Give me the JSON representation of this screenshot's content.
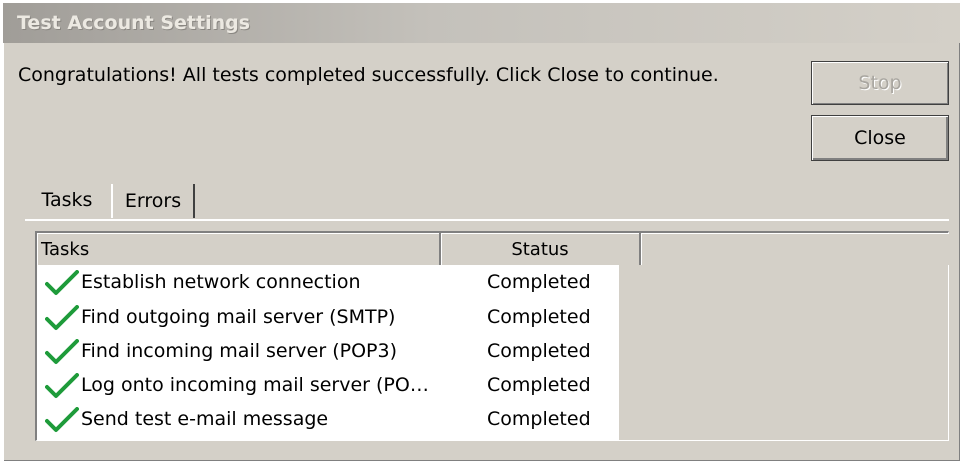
{
  "window": {
    "title": "Test Account Settings"
  },
  "message": "Congratulations! All tests completed successfully. Click Close to continue.",
  "buttons": {
    "stop": "Stop",
    "close": "Close"
  },
  "tabs": [
    {
      "label": "Tasks",
      "selected": true
    },
    {
      "label": "Errors",
      "selected": false
    }
  ],
  "table": {
    "columns": [
      "Tasks",
      "Status"
    ],
    "rows": [
      {
        "task": "Establish network connection",
        "status": "Completed",
        "icon": "check-icon"
      },
      {
        "task": "Find outgoing mail server (SMTP)",
        "status": "Completed",
        "icon": "check-icon"
      },
      {
        "task": "Find incoming mail server (POP3)",
        "status": "Completed",
        "icon": "check-icon"
      },
      {
        "task": "Log onto incoming mail server (PO…",
        "status": "Completed",
        "icon": "check-icon"
      },
      {
        "task": "Send test e-mail message",
        "status": "Completed",
        "icon": "check-icon"
      }
    ]
  },
  "colors": {
    "dialog_bg": "#d4d0c8",
    "check_green": "#1e9b3a",
    "disabled_text": "#a9a6a0"
  }
}
